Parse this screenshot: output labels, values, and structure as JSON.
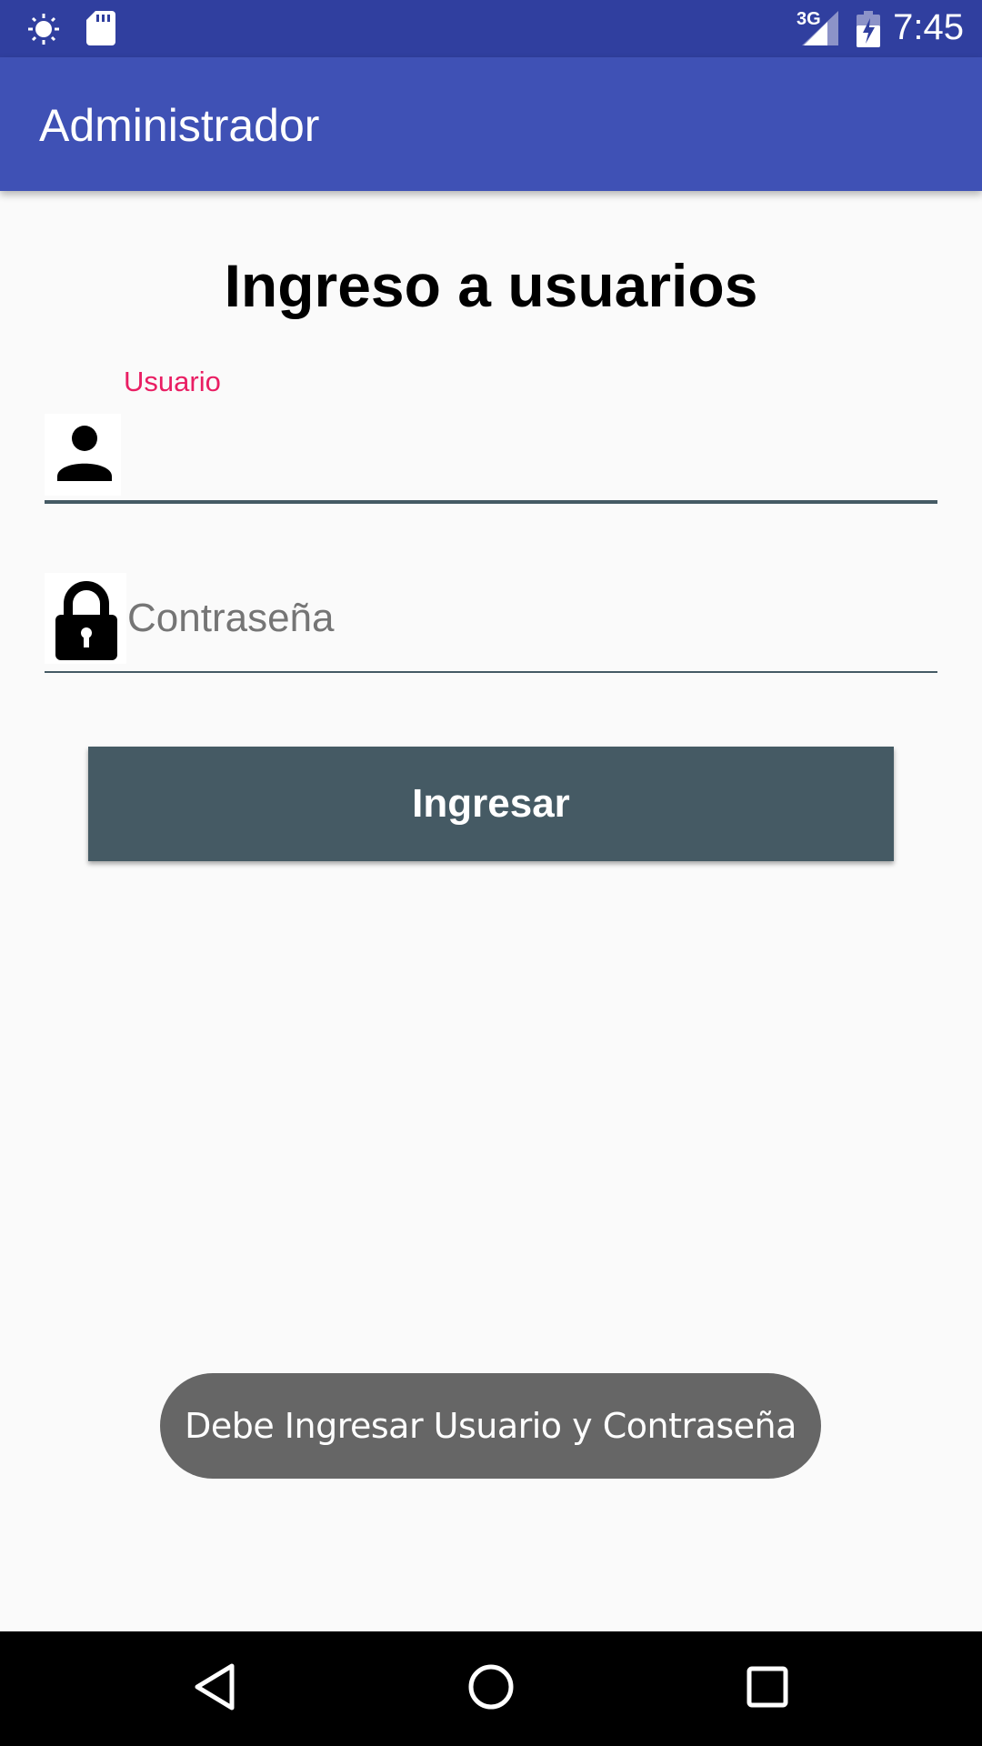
{
  "status_bar": {
    "time": "7:45",
    "network": "3G",
    "icons": [
      "brightness-icon",
      "sd-card-icon",
      "signal-icon",
      "battery-icon"
    ]
  },
  "app_bar": {
    "title": "Administrador",
    "color": "#3f51b5"
  },
  "login": {
    "title": "Ingreso a usuarios",
    "username": {
      "label": "Usuario",
      "value": "",
      "icon": "person-icon"
    },
    "password": {
      "placeholder": "Contraseña",
      "value": "",
      "icon": "lock-icon"
    },
    "submit_label": "Ingresar"
  },
  "toast": {
    "message": "Debe Ingresar Usuario y Contraseña"
  },
  "nav_bar": {
    "buttons": [
      "back-icon",
      "home-icon",
      "recents-icon"
    ]
  },
  "colors": {
    "status_bar": "#303f9f",
    "accent": "#e91e63",
    "button": "#455a64"
  }
}
